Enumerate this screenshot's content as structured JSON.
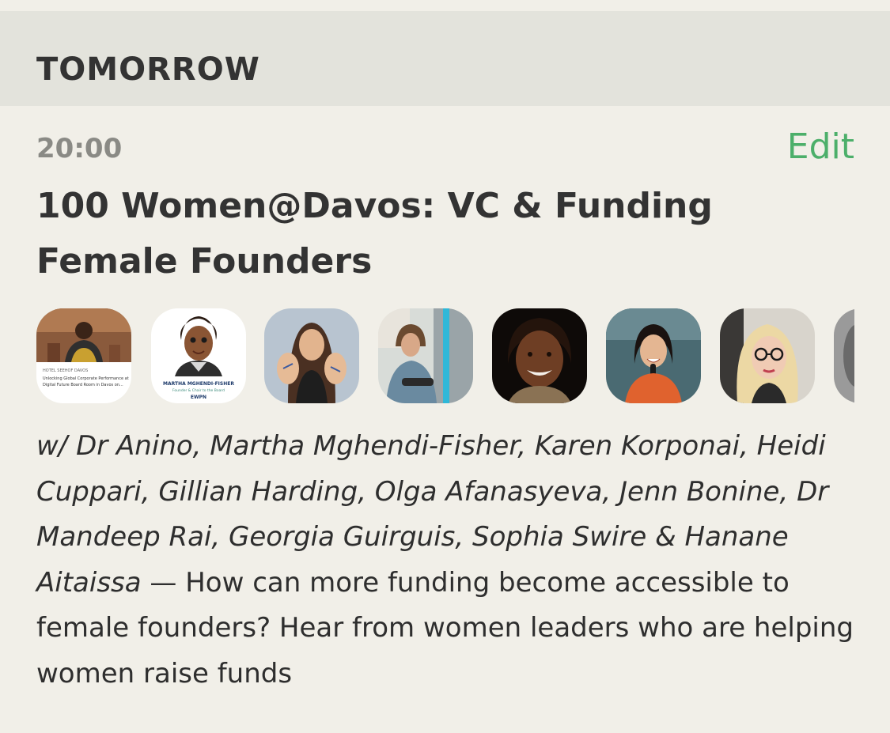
{
  "section": {
    "label": "TOMORROW"
  },
  "event": {
    "time": "20:00",
    "edit_label": "Edit",
    "title": "100 Women@Davos: VC & Funding Female Founders",
    "speakers_text": "w/ Dr Anino, Martha Mghendi-Fisher, Karen Korponai, Heidi Cuppari, Gillian Harding, Olga Afanasyeva, Jenn Bonine, Dr Mandeep Rai, Georgia Guirguis, Sophia Swire & Hanane Aitaissa",
    "separator": " — ",
    "description_text": "How can more funding become accessible to female founders? Hear from women leaders who are helping women raise funds"
  },
  "avatars": [
    {
      "name": "avatar-dr-anino",
      "caption_line1": "HOTEL SEEHOF DAVOS",
      "caption_line2": "Unlocking Global Corporate Performance at",
      "caption_line3": "Digital Future Board Room in Davos on..."
    },
    {
      "name": "avatar-martha-mghendi-fisher",
      "caption_line1": "MARTHA MGHENDI-FISHER",
      "caption_line2": "Founder & Chair to the Board",
      "caption_line3": "EWPN"
    },
    {
      "name": "avatar-karen-korponai"
    },
    {
      "name": "avatar-heidi-cuppari"
    },
    {
      "name": "avatar-gillian-harding"
    },
    {
      "name": "avatar-olga-afanasyeva"
    },
    {
      "name": "avatar-jenn-bonine"
    },
    {
      "name": "avatar-partial"
    }
  ],
  "colors": {
    "background": "#f1efe8",
    "header_background": "#e3e3dc",
    "accent_green": "#4caf6a",
    "time_gray": "#8a8a85",
    "text_dark": "#333333"
  }
}
